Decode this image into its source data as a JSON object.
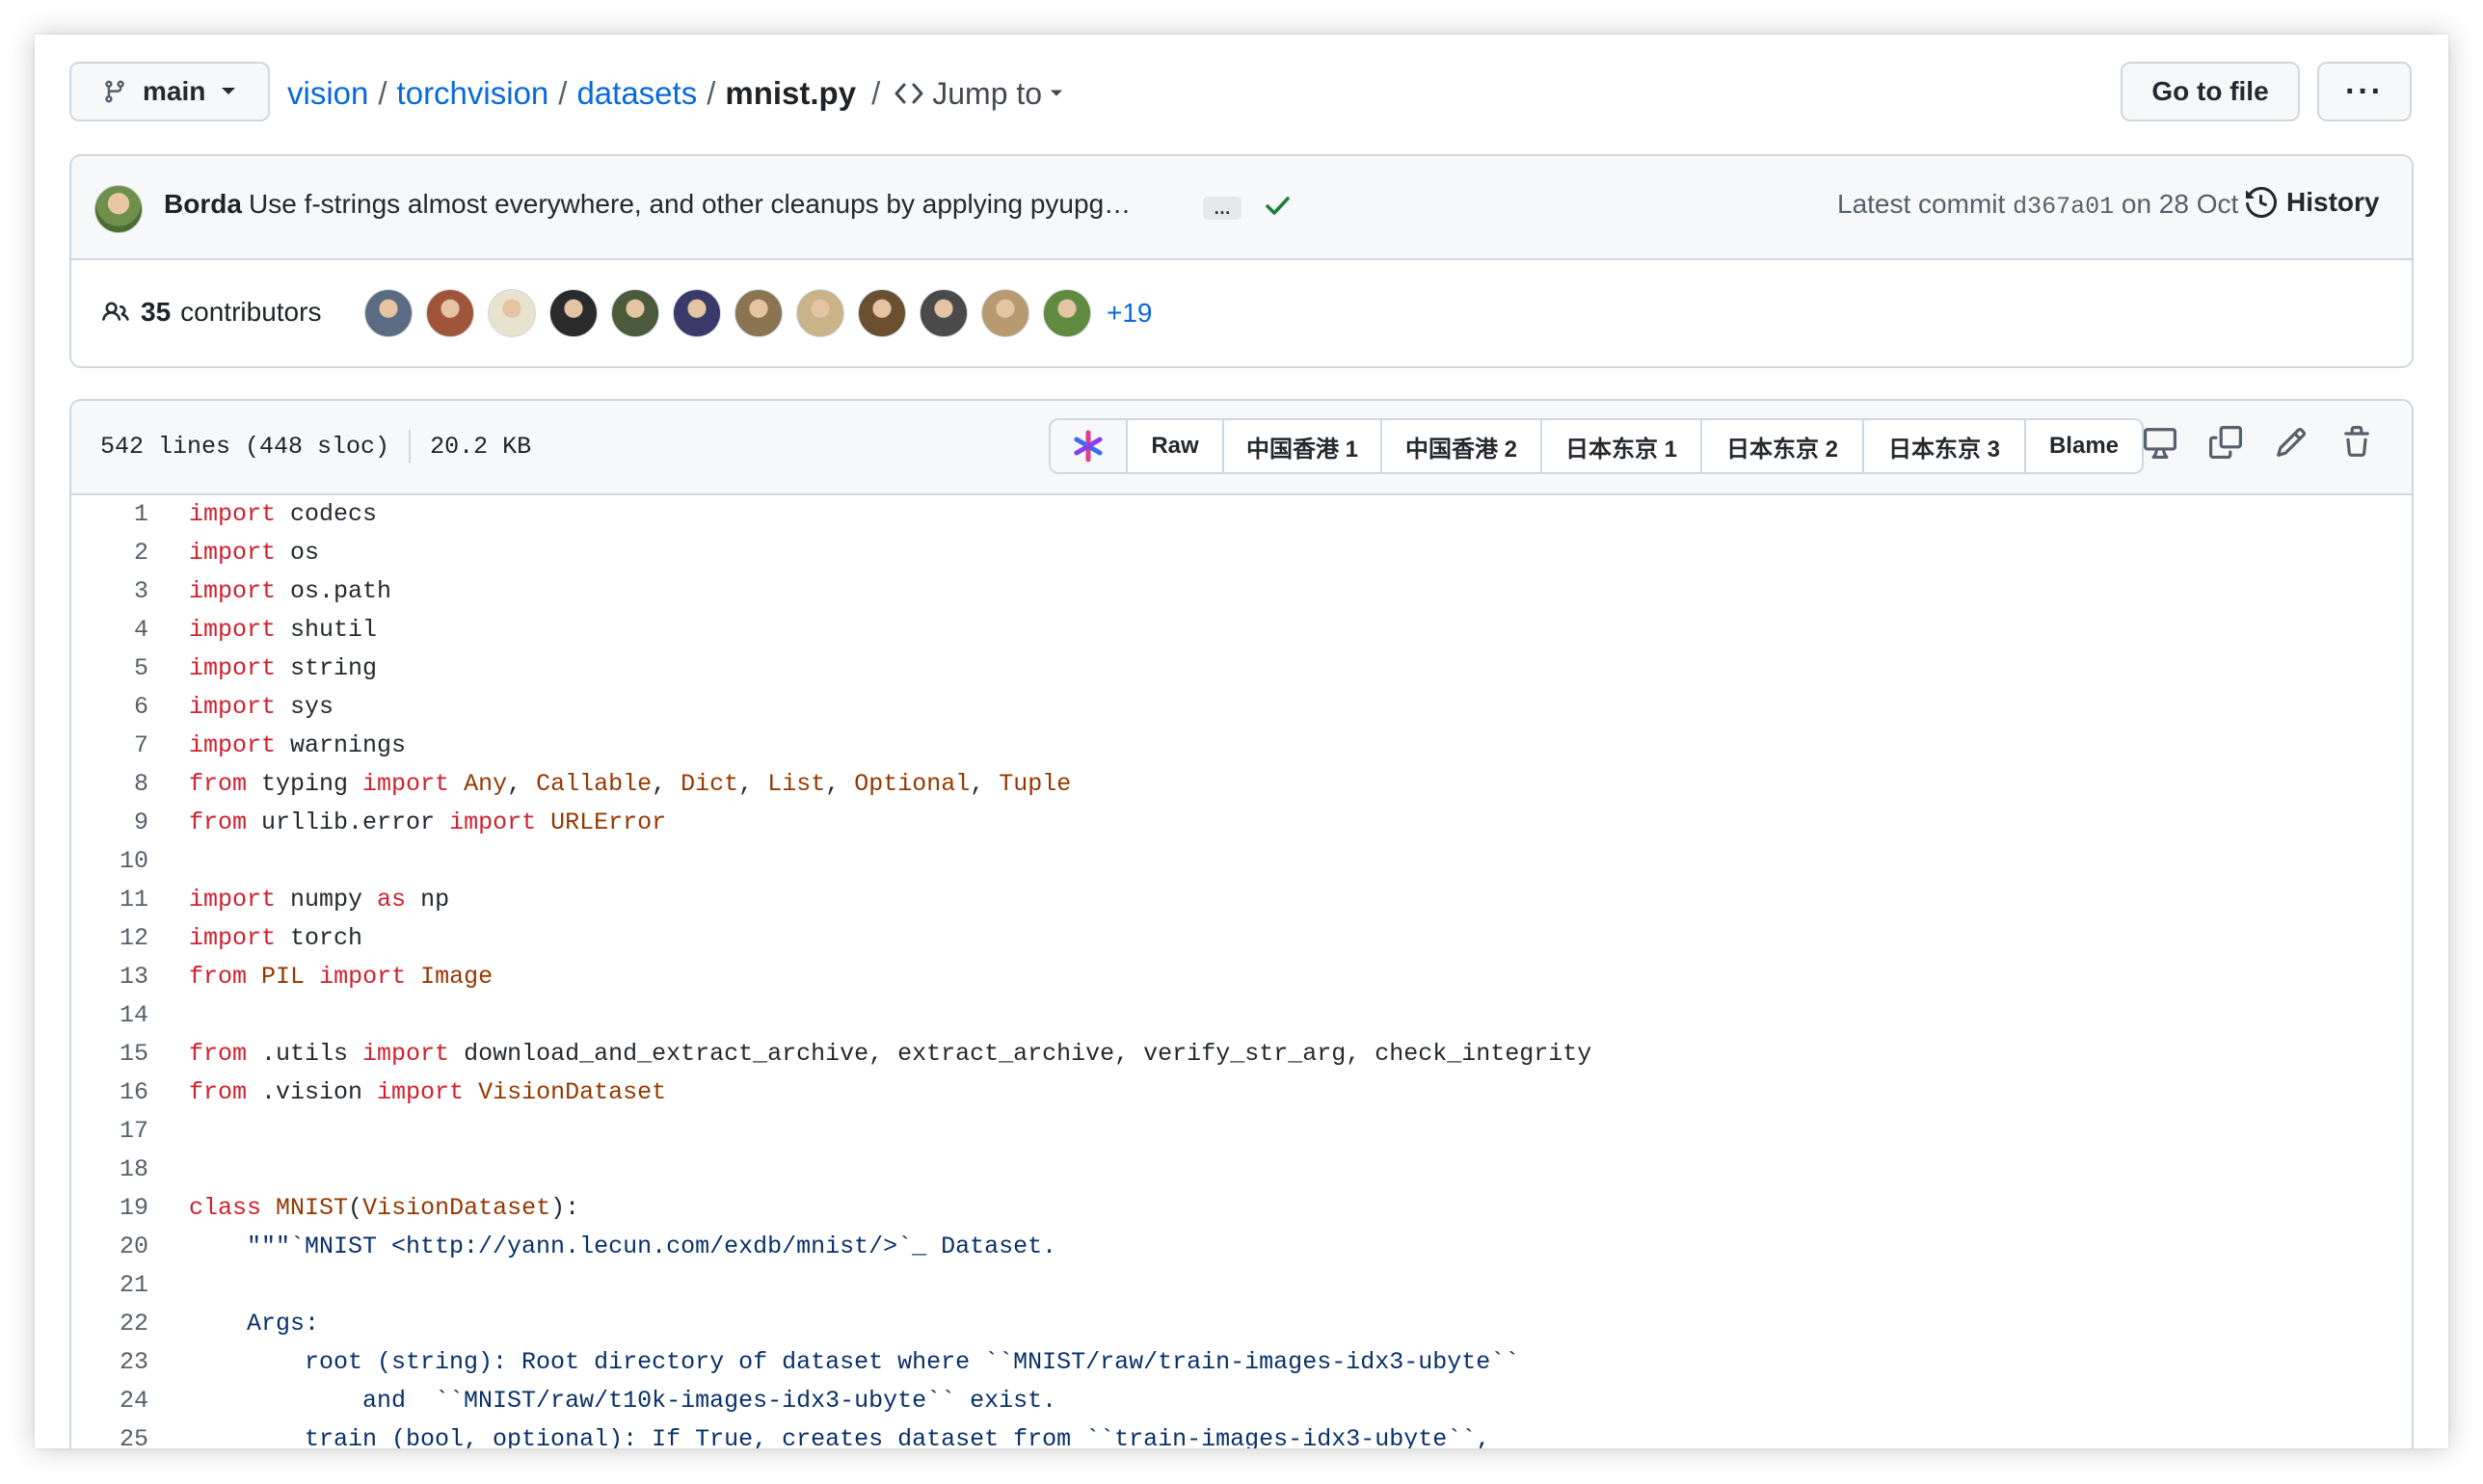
{
  "breadcrumb": {
    "branch": "main",
    "parts": [
      "vision",
      "torchvision",
      "datasets"
    ],
    "separator": "/",
    "file": "mnist.py",
    "jump_to": "Jump to"
  },
  "actions": {
    "go_to_file": "Go to file",
    "more": "···"
  },
  "commit": {
    "author": "Borda",
    "message": "Use f-strings almost everywhere, and other cleanups by applying pyupg…",
    "ellipsis": "…",
    "latest_label": "Latest commit",
    "sha": "d367a01",
    "date_text": "on 28 Oct",
    "history": "History"
  },
  "contributors": {
    "count_text": "35",
    "label": "contributors",
    "more": "+19",
    "avatar_colors": [
      "#5a6b83",
      "#a0553a",
      "#e9e2cf",
      "#2b2a2a",
      "#4a5a3a",
      "#3a3a6a",
      "#8a7550",
      "#c9b48a",
      "#6a5030",
      "#4a4a4a",
      "#b89a70",
      "#5f8a3f"
    ]
  },
  "file_header": {
    "lines": "542 lines (448 sloc)",
    "size": "20.2 KB",
    "buttons": [
      "Raw",
      "中国香港 1",
      "中国香港 2",
      "日本东京 1",
      "日本东京 2",
      "日本东京 3",
      "Blame"
    ]
  },
  "colors": {
    "keyword": "#cf222e",
    "type": "#953800",
    "string": "#0a3069",
    "link": "#0969da",
    "border": "#d0d7de"
  },
  "code_lines": [
    {
      "n": "1",
      "tokens": [
        {
          "t": "import",
          "c": "k"
        },
        {
          "t": " codecs"
        }
      ]
    },
    {
      "n": "2",
      "tokens": [
        {
          "t": "import",
          "c": "k"
        },
        {
          "t": " os"
        }
      ]
    },
    {
      "n": "3",
      "tokens": [
        {
          "t": "import",
          "c": "k"
        },
        {
          "t": " os.path"
        }
      ]
    },
    {
      "n": "4",
      "tokens": [
        {
          "t": "import",
          "c": "k"
        },
        {
          "t": " shutil"
        }
      ]
    },
    {
      "n": "5",
      "tokens": [
        {
          "t": "import",
          "c": "k"
        },
        {
          "t": " string"
        }
      ]
    },
    {
      "n": "6",
      "tokens": [
        {
          "t": "import",
          "c": "k"
        },
        {
          "t": " sys"
        }
      ]
    },
    {
      "n": "7",
      "tokens": [
        {
          "t": "import",
          "c": "k"
        },
        {
          "t": " warnings"
        }
      ]
    },
    {
      "n": "8",
      "tokens": [
        {
          "t": "from",
          "c": "k"
        },
        {
          "t": " typing "
        },
        {
          "t": "import",
          "c": "k"
        },
        {
          "t": " "
        },
        {
          "t": "Any",
          "c": "t"
        },
        {
          "t": ", "
        },
        {
          "t": "Callable",
          "c": "t"
        },
        {
          "t": ", "
        },
        {
          "t": "Dict",
          "c": "t"
        },
        {
          "t": ", "
        },
        {
          "t": "List",
          "c": "t"
        },
        {
          "t": ", "
        },
        {
          "t": "Optional",
          "c": "t"
        },
        {
          "t": ", "
        },
        {
          "t": "Tuple",
          "c": "t"
        }
      ]
    },
    {
      "n": "9",
      "tokens": [
        {
          "t": "from",
          "c": "k"
        },
        {
          "t": " urllib.error "
        },
        {
          "t": "import",
          "c": "k"
        },
        {
          "t": " "
        },
        {
          "t": "URLError",
          "c": "t"
        }
      ]
    },
    {
      "n": "10",
      "tokens": []
    },
    {
      "n": "11",
      "tokens": [
        {
          "t": "import",
          "c": "k"
        },
        {
          "t": " numpy "
        },
        {
          "t": "as",
          "c": "k"
        },
        {
          "t": " np"
        }
      ]
    },
    {
      "n": "12",
      "tokens": [
        {
          "t": "import",
          "c": "k"
        },
        {
          "t": " torch"
        }
      ]
    },
    {
      "n": "13",
      "tokens": [
        {
          "t": "from",
          "c": "k"
        },
        {
          "t": " "
        },
        {
          "t": "PIL",
          "c": "t"
        },
        {
          "t": " "
        },
        {
          "t": "import",
          "c": "k"
        },
        {
          "t": " "
        },
        {
          "t": "Image",
          "c": "t"
        }
      ]
    },
    {
      "n": "14",
      "tokens": []
    },
    {
      "n": "15",
      "tokens": [
        {
          "t": "from",
          "c": "k"
        },
        {
          "t": " .utils "
        },
        {
          "t": "import",
          "c": "k"
        },
        {
          "t": " download_and_extract_archive, extract_archive, verify_str_arg, check_integrity"
        }
      ]
    },
    {
      "n": "16",
      "tokens": [
        {
          "t": "from",
          "c": "k"
        },
        {
          "t": " .vision "
        },
        {
          "t": "import",
          "c": "k"
        },
        {
          "t": " "
        },
        {
          "t": "VisionDataset",
          "c": "t"
        }
      ]
    },
    {
      "n": "17",
      "tokens": []
    },
    {
      "n": "18",
      "tokens": []
    },
    {
      "n": "19",
      "tokens": [
        {
          "t": "class",
          "c": "k"
        },
        {
          "t": " "
        },
        {
          "t": "MNIST",
          "c": "t"
        },
        {
          "t": "("
        },
        {
          "t": "VisionDataset",
          "c": "t"
        },
        {
          "t": "):"
        }
      ]
    },
    {
      "n": "20",
      "tokens": [
        {
          "t": "    \"\"\"`MNIST <http://yann.lecun.com/exdb/mnist/>`_ Dataset.",
          "c": "s"
        }
      ]
    },
    {
      "n": "21",
      "tokens": []
    },
    {
      "n": "22",
      "tokens": [
        {
          "t": "    Args:",
          "c": "s"
        }
      ]
    },
    {
      "n": "23",
      "tokens": [
        {
          "t": "        root (string): Root directory of dataset where ``MNIST/raw/train-images-idx3-ubyte``",
          "c": "s"
        }
      ]
    },
    {
      "n": "24",
      "tokens": [
        {
          "t": "            and  ``MNIST/raw/t10k-images-idx3-ubyte`` exist.",
          "c": "s"
        }
      ]
    },
    {
      "n": "25",
      "tokens": [
        {
          "t": "        train (bool, optional): If True, creates dataset from ``train-images-idx3-ubyte``,",
          "c": "s"
        }
      ]
    }
  ]
}
